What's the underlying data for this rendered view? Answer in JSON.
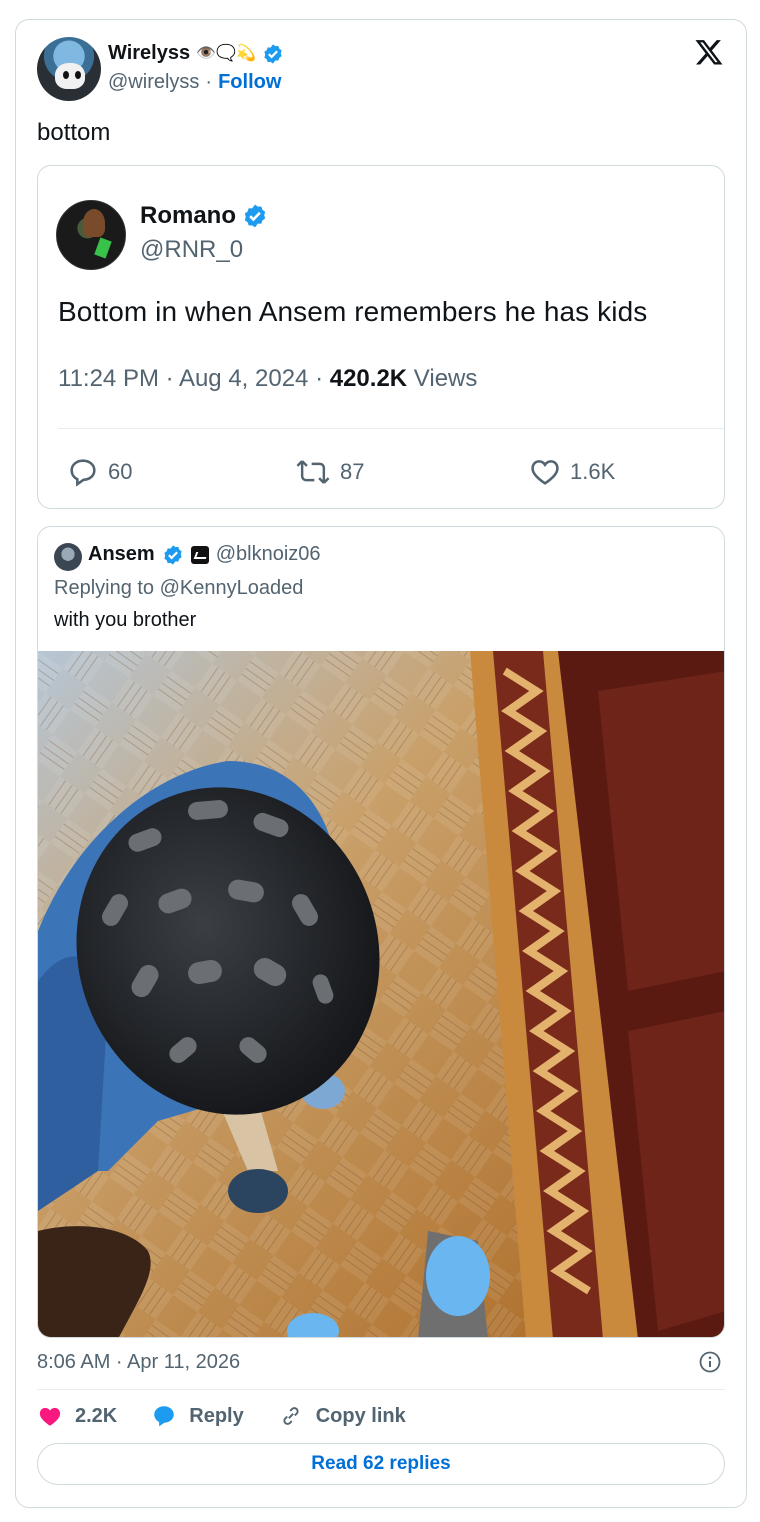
{
  "author": {
    "display_name": "Wirelyss",
    "emojis": "👁️🗨️💫",
    "handle": "@wirelyss",
    "separator": "·",
    "follow_label": "Follow"
  },
  "tweet_text": "bottom",
  "quoted_1": {
    "display_name": "Romano",
    "handle": "@RNR_0",
    "text": "Bottom in when Ansem remembers he has kids",
    "time": "11:24 PM · Aug 4, 2024 · ",
    "views_count": "420.2K",
    "views_label": " Views",
    "replies": "60",
    "reposts": "87",
    "likes": "1.6K"
  },
  "quoted_2": {
    "display_name": "Ansem",
    "handle": "@blknoiz06",
    "replying_to": "Replying to @KennyLoaded",
    "text": "with you brother"
  },
  "footer": {
    "timestamp": "8:06 AM · Apr 11, 2026",
    "likes": "2.2K",
    "reply_label": "Reply",
    "copy_label": "Copy link",
    "read_replies": "Read 62 replies"
  },
  "colors": {
    "verified": "#1d9bf0",
    "like": "#f91880",
    "link": "#006fd6"
  }
}
